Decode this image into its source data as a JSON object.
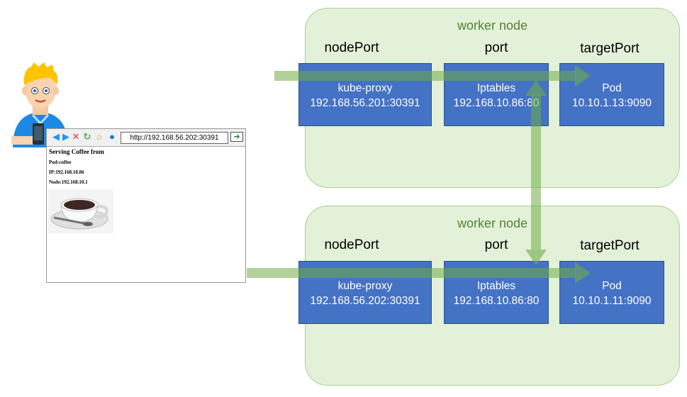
{
  "nodes": [
    {
      "title": "worker node",
      "headers": {
        "node_port": "nodePort",
        "port": "port",
        "target_port": "targetPort"
      },
      "kube_proxy": {
        "name": "kube-proxy",
        "address": "192.168.56.201:30391"
      },
      "iptables": {
        "name": "Iptables",
        "address": "192.168.10.86:80"
      },
      "pod": {
        "name": "Pod",
        "address": "10.10.1.13:9090"
      }
    },
    {
      "title": "worker node",
      "headers": {
        "node_port": "nodePort",
        "port": "port",
        "target_port": "targetPort"
      },
      "kube_proxy": {
        "name": "kube-proxy",
        "address": "192.168.56.202:30391"
      },
      "iptables": {
        "name": "Iptables",
        "address": "192.168.10.86:80"
      },
      "pod": {
        "name": "Pod",
        "address": "10.10.1.11:9090"
      }
    }
  ],
  "browser": {
    "url": "http://192.168.56.202:30391",
    "heading": "Serving Coffee from",
    "pod_line": "Pod:coffee",
    "ip_line": "IP:192.168.10.86",
    "node_line": "Node:192.168.10.1"
  },
  "colors": {
    "node_bg": "#e4f1d9",
    "node_title": "#548235",
    "box": "#4472c4",
    "flow": "#70ad47"
  }
}
